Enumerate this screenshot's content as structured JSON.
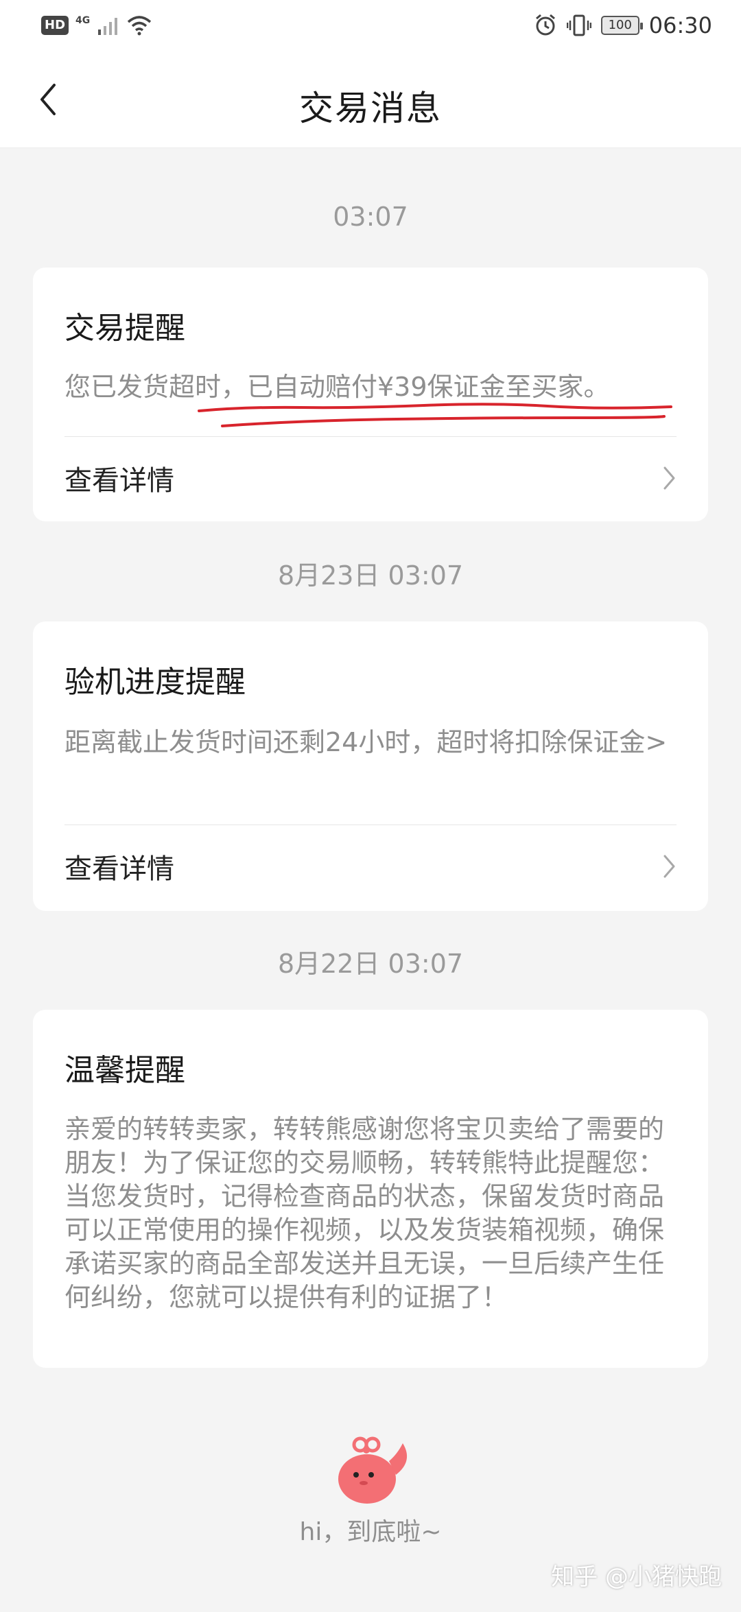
{
  "status_bar": {
    "hd": "HD",
    "network": "4G",
    "battery": "100",
    "time": "06:30"
  },
  "header": {
    "title": "交易消息"
  },
  "messages": [
    {
      "time": "03:07",
      "title": "交易提醒",
      "body": "您已发货超时，已自动赔付¥39保证金至买家。",
      "detail_label": "查看详情"
    },
    {
      "time": "8月23日 03:07",
      "title": "验机进度提醒",
      "body": "距离截止发货时间还剩24小时，超时将扣除保证金>",
      "detail_label": "查看详情"
    },
    {
      "time": "8月22日 03:07",
      "title": "温馨提醒",
      "body": "亲爱的转转卖家，转转熊感谢您将宝贝卖给了需要的朋友！为了保证您的交易顺畅，转转熊特此提醒您：当您发货时，记得检查商品的状态，保留发货时商品可以正常使用的操作视频，以及发货装箱视频，确保承诺买家的商品全部发送并且无误，一旦后续产生任何纠纷，您就可以提供有利的证据了！"
    }
  ],
  "footer": {
    "end_text": "hi，到底啦~"
  },
  "watermark": "知乎 @小猪快跑",
  "colors": {
    "background": "#f4f4f4",
    "card": "#ffffff",
    "annotation": "#d8242c",
    "mascot": "#f36f74"
  }
}
